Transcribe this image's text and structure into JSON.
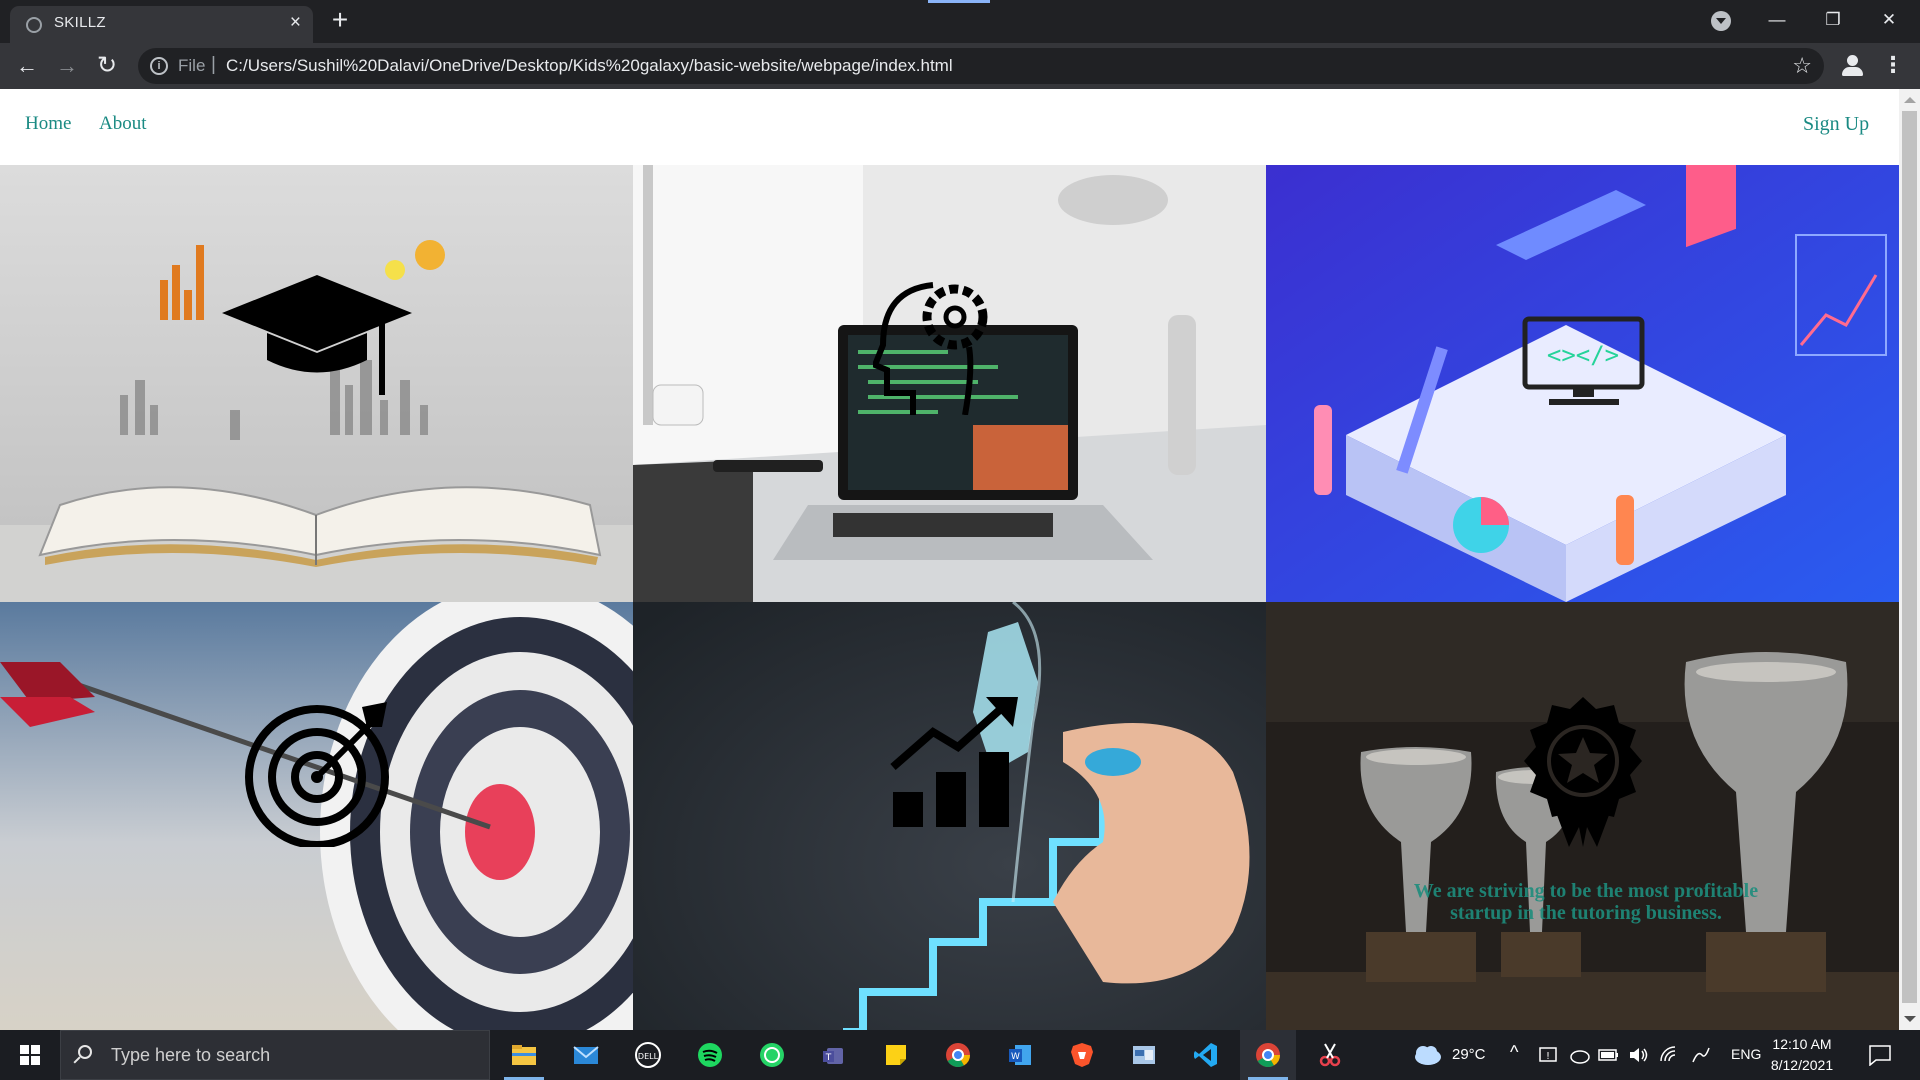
{
  "browser": {
    "tab_title": "SKILLZ",
    "tab_close": "×",
    "new_tab": "+",
    "omnibox_label": "File",
    "omnibox_separator": "|",
    "url": "C:/Users/Sushil%20Dalavi/OneDrive/Desktop/Kids%20galaxy/basic-website/webpage/index.html",
    "back": "←",
    "forward": "→",
    "reload": "↻",
    "info_icon": "i",
    "bookmark_icon": "☆",
    "menu_icon": "⋮",
    "window_minimize": "—",
    "window_restore": "❐",
    "window_close": "✕"
  },
  "site": {
    "nav_left": [
      "Home",
      "About"
    ],
    "nav_right": "Sign Up",
    "tagline": "We are striving to be the most profitable startup in the tutoring business.",
    "accent_color": "#1a8a83"
  },
  "tiles": [
    {
      "name": "education",
      "icon": "graduation-cap-icon"
    },
    {
      "name": "development",
      "icon": "head-gear-icon"
    },
    {
      "name": "coding",
      "icon": "monitor-code-icon"
    },
    {
      "name": "target",
      "icon": "target-icon"
    },
    {
      "name": "growth",
      "icon": "growth-chart-icon"
    },
    {
      "name": "achievement",
      "icon": "award-badge-icon"
    }
  ],
  "taskbar": {
    "search_placeholder": "Type here to search",
    "weather_temp": "29°C",
    "language": "ENG",
    "time": "12:10 AM",
    "date": "8/12/2021",
    "apps": [
      "file-explorer",
      "mail",
      "dell",
      "spotify",
      "whatsapp",
      "teams",
      "sticky-notes",
      "chrome",
      "word",
      "brave",
      "control-panel",
      "vscode",
      "chrome-active",
      "snipping-tool"
    ]
  }
}
